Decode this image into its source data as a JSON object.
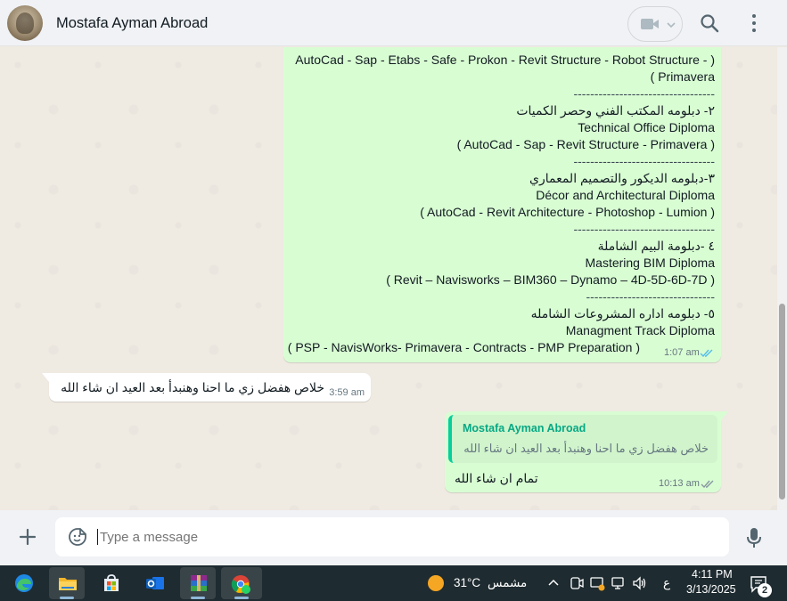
{
  "header": {
    "contact_name": "Mostafa Ayman Abroad"
  },
  "messages": {
    "outgoing_1": {
      "lines": [
        "AutoCad - Sap - Etabs - Safe - Prokon - Revit Structure - Robot Structure - )",
        "( Primavera",
        "----------------------------------",
        "٢- دبلومه المكتب الفني وحصر الكميات",
        "Technical Office Diploma",
        "( AutoCad - Sap - Revit Structure - Primavera )",
        "----------------------------------",
        "٣-دبلومه الديكور والتصميم المعماري",
        "Décor and Architectural Diploma",
        "( AutoCad - Revit Architecture - Photoshop - Lumion )",
        "----------------------------------",
        "٤ -دبلومة البيم الشاملة",
        "Mastering BIM Diploma",
        "( Revit – Navisworks – BIM360 – Dynamo – 4D-5D-6D-7D )",
        "-------------------------------",
        "٥- دبلومه اداره المشروعات الشامله",
        "Managment Track Diploma",
        "( PSP - NavisWorks- Primavera - Contracts - PMP Preparation )"
      ],
      "time": "1:07 am"
    },
    "incoming_1": {
      "text": "خلاص هفضل زي ما احنا وهنبدأ بعد العيد ان شاء الله",
      "time": "3:59 am"
    },
    "outgoing_2": {
      "quoted_author": "Mostafa Ayman Abroad",
      "quoted_text": "خلاص هفضل زي ما احنا وهنبدأ بعد العيد ان شاء الله",
      "text": "تمام ان شاء الله",
      "time": "10:13 am"
    }
  },
  "composer": {
    "placeholder": "Type a message"
  },
  "taskbar": {
    "weather_temp": "31°C",
    "weather_desc": "مشمس",
    "lang": "ع",
    "time": "4:11 PM",
    "date": "3/13/2025",
    "notification_count": "2"
  },
  "colors": {
    "outgoing_bubble": "#d9fdd3",
    "incoming_bubble": "#ffffff",
    "read_ticks": "#53bdeb",
    "quote_accent": "#06cf9c",
    "taskbar": "#1e2b30"
  }
}
